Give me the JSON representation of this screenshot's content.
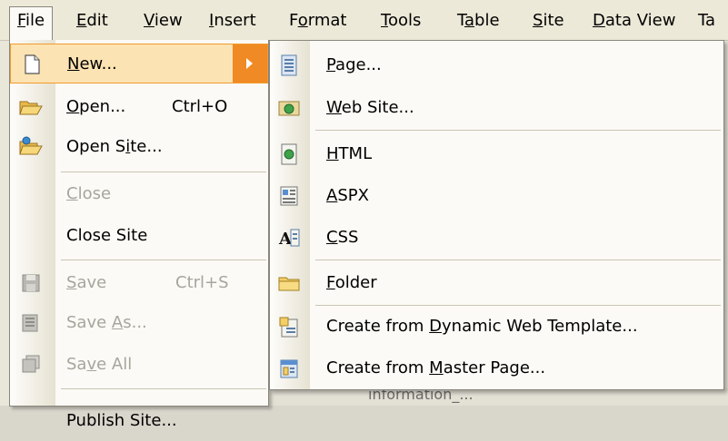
{
  "menubar": {
    "items": [
      {
        "label": "File"
      },
      {
        "label": "Edit"
      },
      {
        "label": "View"
      },
      {
        "label": "Insert"
      },
      {
        "label": "Format"
      },
      {
        "label": "Tools"
      },
      {
        "label": "Table"
      },
      {
        "label": "Site"
      },
      {
        "label": "Data View"
      },
      {
        "label": "Ta"
      }
    ]
  },
  "file_menu": {
    "items": [
      {
        "label": "New...",
        "shortcut": "",
        "icon": "new-page-icon",
        "enabled": true,
        "submenu": true
      },
      {
        "label": "Open...",
        "shortcut": "Ctrl+O",
        "icon": "open-folder-icon",
        "enabled": true
      },
      {
        "label": "Open Site...",
        "shortcut": "",
        "icon": "open-site-icon",
        "enabled": true
      },
      {
        "label": "Close",
        "shortcut": "",
        "enabled": false
      },
      {
        "label": "Close Site",
        "shortcut": "",
        "enabled": true
      },
      {
        "label": "Save",
        "shortcut": "Ctrl+S",
        "icon": "save-icon",
        "enabled": false
      },
      {
        "label": "Save As...",
        "shortcut": "",
        "icon": "save-as-icon",
        "enabled": false
      },
      {
        "label": "Save All",
        "shortcut": "",
        "icon": "save-all-icon",
        "enabled": false
      },
      {
        "label": "Publish Site...",
        "shortcut": "",
        "enabled": true
      }
    ]
  },
  "new_submenu": {
    "items": [
      {
        "label": "Page...",
        "icon": "page-icon"
      },
      {
        "label": "Web Site...",
        "icon": "web-site-icon"
      },
      {
        "label": "HTML",
        "icon": "html-icon"
      },
      {
        "label": "ASPX",
        "icon": "aspx-icon"
      },
      {
        "label": "CSS",
        "icon": "css-icon"
      },
      {
        "label": "Folder",
        "icon": "folder-icon"
      },
      {
        "label": "Create from Dynamic Web Template...",
        "icon": "dynamic-web-template-icon"
      },
      {
        "label": "Create from Master Page...",
        "icon": "master-page-icon"
      }
    ]
  },
  "background": {
    "peek_text": "information_..."
  },
  "colors": {
    "menu_bg": "#fbfaf6",
    "menubar_bg": "#ece9d8",
    "highlight_bg": "#fce3b3",
    "highlight_border": "#f29b2d",
    "submenu_arrow": "#f08a24",
    "disabled_text": "#a7a59c"
  }
}
